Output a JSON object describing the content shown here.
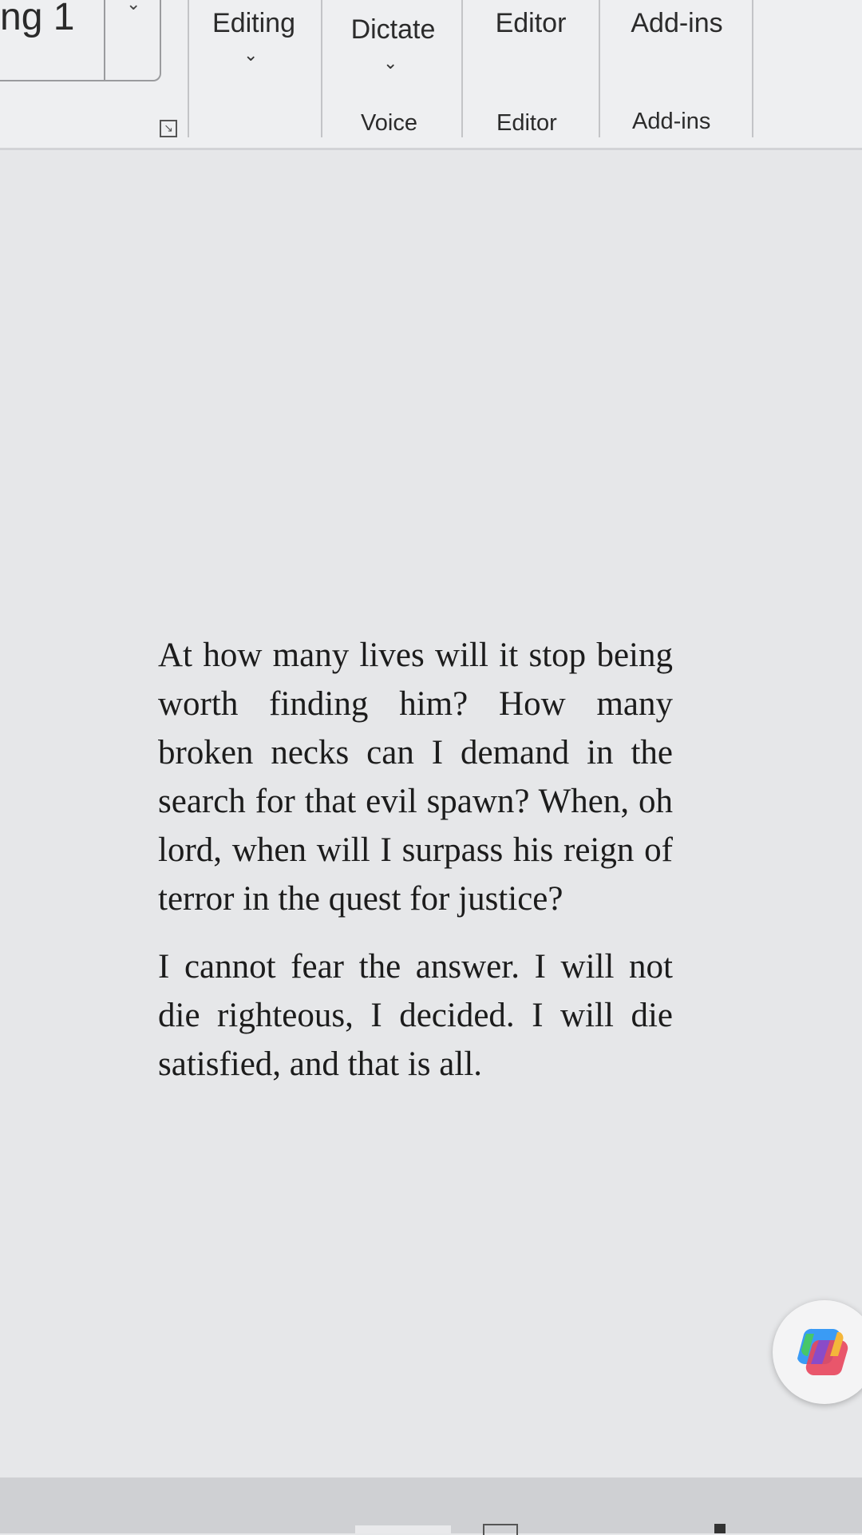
{
  "ribbon": {
    "style_fragment": "ng 1",
    "groups": [
      {
        "button": "Editing",
        "label": ""
      },
      {
        "button": "Dictate",
        "label": "Voice"
      },
      {
        "button": "Editor",
        "label": "Editor"
      },
      {
        "button": "Add-ins",
        "label": "Add-ins"
      }
    ],
    "icons": {
      "gallery": "chevron-down-icon",
      "launcher": "dialog-launcher-icon",
      "copilot": "copilot-icon"
    }
  },
  "document": {
    "paragraphs": [
      "At how many lives will it stop being worth finding him? How many broken necks can I demand in the search for that evil spawn? When, oh lord, when will I surpass his reign of terror in the quest for justice?",
      "I cannot fear the answer. I will not die righteous, I decided. I will die satisfied, and that is all."
    ]
  }
}
